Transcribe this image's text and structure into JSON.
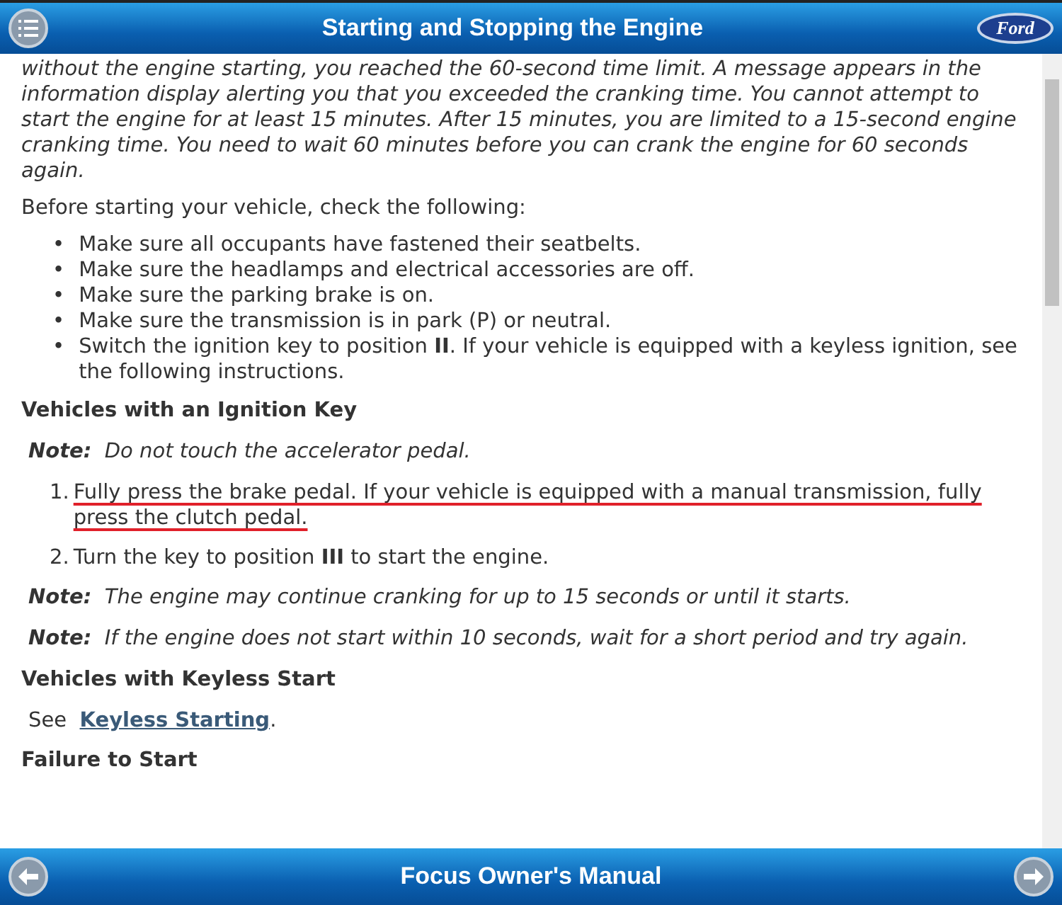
{
  "header": {
    "title": "Starting and Stopping the Engine",
    "logo_text": "Ford"
  },
  "content": [
    {
      "kind": "italic",
      "text": "without the engine starting, you reached the 60-second time limit. A message appears in the information display alerting you that you exceeded the cranking time. You cannot attempt to start the engine for at least 15 minutes. After 15 minutes, you are limited to a 15-second engine cranking time. You need to wait 60 minutes before you can crank the engine for 60 seconds again."
    },
    {
      "kind": "paragraph",
      "text": "Before starting your vehicle, check the following:"
    },
    {
      "kind": "bullets",
      "marker": "•",
      "items": [
        "Make sure all occupants have fastened their seatbelts.",
        "Make sure the headlamps and electrical accessories are off.",
        "Make sure the parking brake is on.",
        "Make sure the transmission is in park (P) or neutral.",
        "Switch the ignition key to position **II**. If your vehicle is equipped with a keyless ignition, see the following instructions."
      ]
    },
    {
      "kind": "heading",
      "text": "Vehicles with an Ignition Key"
    },
    {
      "kind": "note",
      "label": "Note:",
      "text": "Do not touch the accelerator pedal."
    },
    {
      "kind": "steps",
      "items": [
        {
          "number": "1.",
          "text": "Fully press the brake pedal. If your vehicle is equipped with a manual transmission, fully press the clutch pedal.",
          "highlighted": true
        },
        {
          "number": "2.",
          "text": "Turn the key to position **III** to start the engine.",
          "highlighted": false
        }
      ]
    },
    {
      "kind": "note",
      "label": "Note:",
      "text": "The engine may continue cranking for up to 15 seconds or until it starts."
    },
    {
      "kind": "note",
      "label": "Note:",
      "text": "If the engine does not start within 10 seconds, wait for a short period and try again."
    },
    {
      "kind": "heading",
      "text": "Vehicles with Keyless Start"
    },
    {
      "kind": "link",
      "before": "See",
      "link": "Keyless Starting",
      "after": "."
    },
    {
      "kind": "heading",
      "text": "Failure to Start"
    }
  ],
  "footer": {
    "title": "Focus Owner's Manual"
  }
}
